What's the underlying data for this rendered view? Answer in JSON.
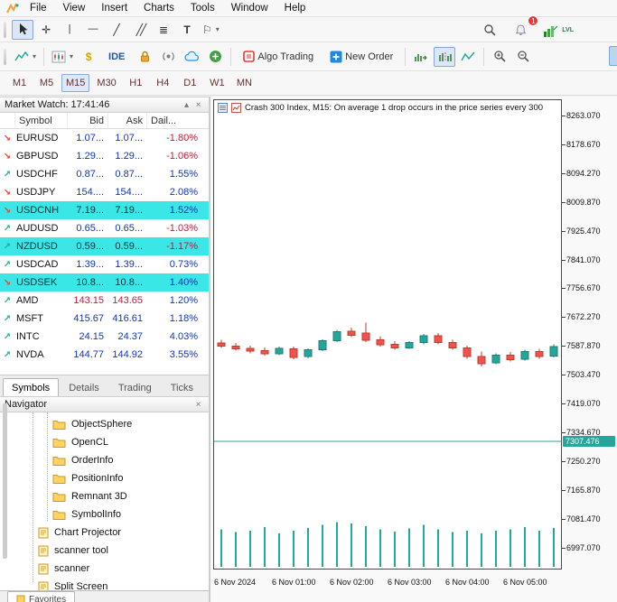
{
  "menu": {
    "items": [
      "File",
      "View",
      "Insert",
      "Charts",
      "Tools",
      "Window",
      "Help"
    ]
  },
  "toolbar_standard": {
    "notification_count": "1",
    "lvl_label": "LVL"
  },
  "toolbar_trading": {
    "ide_label": "IDE",
    "algo_trading_label": "Algo Trading",
    "new_order_label": "New Order"
  },
  "timeframes": {
    "items": [
      "M1",
      "M5",
      "M15",
      "M30",
      "H1",
      "H4",
      "D1",
      "W1",
      "MN"
    ],
    "active": "M15"
  },
  "market_watch": {
    "title": "Market Watch: 17:41:46",
    "columns": [
      "Symbol",
      "Bid",
      "Ask",
      "Dail..."
    ],
    "rows": [
      {
        "dir": "down",
        "symbol": "EURUSD",
        "bid": "1.07...",
        "ask": "1.07...",
        "daily": "-1.80%",
        "highlight": false
      },
      {
        "dir": "down",
        "symbol": "GBPUSD",
        "bid": "1.29...",
        "ask": "1.29...",
        "daily": "-1.06%",
        "highlight": false
      },
      {
        "dir": "up",
        "symbol": "USDCHF",
        "bid": "0.87...",
        "ask": "0.87...",
        "daily": "1.55%",
        "highlight": false
      },
      {
        "dir": "down",
        "symbol": "USDJPY",
        "bid": "154....",
        "ask": "154....",
        "daily": "2.08%",
        "highlight": false
      },
      {
        "dir": "down",
        "symbol": "USDCNH",
        "bid": "7.19...",
        "ask": "7.19...",
        "daily": "1.52%",
        "highlight": true
      },
      {
        "dir": "up",
        "symbol": "AUDUSD",
        "bid": "0.65...",
        "ask": "0.65...",
        "daily": "-1.03%",
        "highlight": false
      },
      {
        "dir": "up",
        "symbol": "NZDUSD",
        "bid": "0.59...",
        "ask": "0.59...",
        "daily": "-1.17%",
        "highlight": true
      },
      {
        "dir": "up",
        "symbol": "USDCAD",
        "bid": "1.39...",
        "ask": "1.39...",
        "daily": "0.73%",
        "highlight": false
      },
      {
        "dir": "down",
        "symbol": "USDSEK",
        "bid": "10.8...",
        "ask": "10.8...",
        "daily": "1.40%",
        "highlight": true
      },
      {
        "dir": "up",
        "symbol": "AMD",
        "bid": "143.15",
        "ask": "143.65",
        "daily": "1.20%",
        "highlight": false,
        "quote_color": "#c21a3f"
      },
      {
        "dir": "up",
        "symbol": "MSFT",
        "bid": "415.67",
        "ask": "416.61",
        "daily": "1.18%",
        "highlight": false
      },
      {
        "dir": "up",
        "symbol": "INTC",
        "bid": "24.15",
        "ask": "24.37",
        "daily": "4.03%",
        "highlight": false
      },
      {
        "dir": "up",
        "symbol": "NVDA",
        "bid": "144.77",
        "ask": "144.92",
        "daily": "3.55%",
        "highlight": false
      }
    ],
    "tabs": [
      "Symbols",
      "Details",
      "Trading",
      "Ticks"
    ],
    "active_tab": "Symbols"
  },
  "navigator": {
    "title": "Navigator",
    "tree": [
      {
        "label": "ObjectSphere",
        "type": "folder"
      },
      {
        "label": "OpenCL",
        "type": "folder"
      },
      {
        "label": "OrderInfo",
        "type": "folder"
      },
      {
        "label": "PositionInfo",
        "type": "folder"
      },
      {
        "label": "Remnant 3D",
        "type": "folder"
      },
      {
        "label": "SymbolInfo",
        "type": "folder"
      },
      {
        "label": "Chart Projector",
        "type": "script"
      },
      {
        "label": "scanner tool",
        "type": "script"
      },
      {
        "label": "scanner",
        "type": "script"
      },
      {
        "label": "Split Screen",
        "type": "script"
      }
    ],
    "bottom_tab": "Favorites"
  },
  "chart": {
    "title": "Crash 300 Index, M15:  On average 1 drop occurs in the price series every 300",
    "current_price": "7307.476",
    "colors": {
      "up": "#26a69a",
      "down": "#ef5350",
      "up_stroke": "#1d7d76",
      "down_stroke": "#c0392b"
    },
    "chart_data": {
      "type": "candlestick+volume",
      "symbol": "Crash 300 Index",
      "timeframe": "M15",
      "y_ticks": [
        "8263.070",
        "8178.670",
        "8094.270",
        "8009.870",
        "7925.470",
        "7841.070",
        "7756.670",
        "7672.270",
        "7587.870",
        "7503.470",
        "7419.070",
        "7334.670",
        "7250.270",
        "7165.870",
        "7081.470",
        "6997.070"
      ],
      "x_labels": [
        "6 Nov 2024",
        "6 Nov 01:00",
        "6 Nov 02:00",
        "6 Nov 03:00",
        "6 Nov 04:00",
        "6 Nov 05:00"
      ],
      "current_price": 7307.476,
      "candles": [
        [
          7596,
          7606,
          7582,
          7587
        ],
        [
          7587,
          7596,
          7574,
          7579
        ],
        [
          7581,
          7589,
          7566,
          7572
        ],
        [
          7574,
          7583,
          7559,
          7564
        ],
        [
          7564,
          7586,
          7560,
          7581
        ],
        [
          7579,
          7586,
          7549,
          7554
        ],
        [
          7556,
          7581,
          7551,
          7577
        ],
        [
          7577,
          7607,
          7573,
          7603
        ],
        [
          7603,
          7635,
          7599,
          7629
        ],
        [
          7631,
          7641,
          7613,
          7619
        ],
        [
          7626,
          7656,
          7599,
          7604
        ],
        [
          7606,
          7616,
          7586,
          7591
        ],
        [
          7593,
          7601,
          7576,
          7582
        ],
        [
          7582,
          7601,
          7579,
          7597
        ],
        [
          7597,
          7623,
          7593,
          7618
        ],
        [
          7618,
          7626,
          7593,
          7598
        ],
        [
          7598,
          7606,
          7576,
          7582
        ],
        [
          7582,
          7589,
          7550,
          7556
        ],
        [
          7556,
          7571,
          7528,
          7536
        ],
        [
          7538,
          7566,
          7534,
          7561
        ],
        [
          7561,
          7570,
          7542,
          7547
        ],
        [
          7549,
          7576,
          7545,
          7571
        ],
        [
          7571,
          7579,
          7550,
          7556
        ],
        [
          7558,
          7592,
          7554,
          7586
        ]
      ],
      "volumes": [
        52,
        48,
        50,
        55,
        46,
        50,
        54,
        58,
        62,
        60,
        56,
        52,
        49,
        53,
        58,
        52,
        48,
        50,
        46,
        50,
        52,
        55,
        50,
        54
      ]
    }
  }
}
